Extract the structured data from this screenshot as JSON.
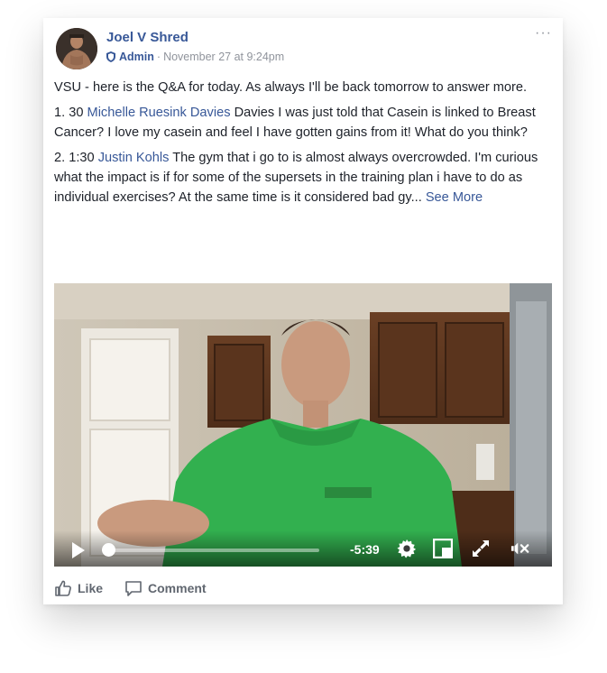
{
  "post": {
    "author": "Joel V Shred",
    "role": "Admin",
    "separator": "·",
    "timestamp": "November 27 at 9:24pm",
    "more_glyph": "···",
    "intro": "VSU - here is the Q&A for today. As always I'll be back tomorrow to answer more.",
    "questions": [
      {
        "prefix": "1. 30",
        "name": "Michelle Ruesink Davies",
        "text": "Davies I was just told that Casein is linked to Breast Cancer? I love my casein and feel I have gotten gains from it! What do you think?"
      },
      {
        "prefix": "2. 1:30",
        "name": "Justin Kohls",
        "text": "The gym that i go to is almost always overcrowded. I'm curious what the impact is if for some of the supersets in the training plan i have to do as individual exercises? At the same time is it considered bad gy...",
        "see_more": "See More"
      }
    ]
  },
  "video": {
    "time_remaining": "-5:39",
    "progress": 0.0,
    "icons": [
      "play-icon",
      "settings-gear-icon",
      "picture-in-picture-icon",
      "fullscreen-icon",
      "muted-speaker-icon"
    ]
  },
  "actions": {
    "like_label": "Like",
    "comment_label": "Comment"
  },
  "colors": {
    "link": "#385898",
    "text": "#1d2129",
    "muted": "#90949c",
    "action": "#616770"
  }
}
